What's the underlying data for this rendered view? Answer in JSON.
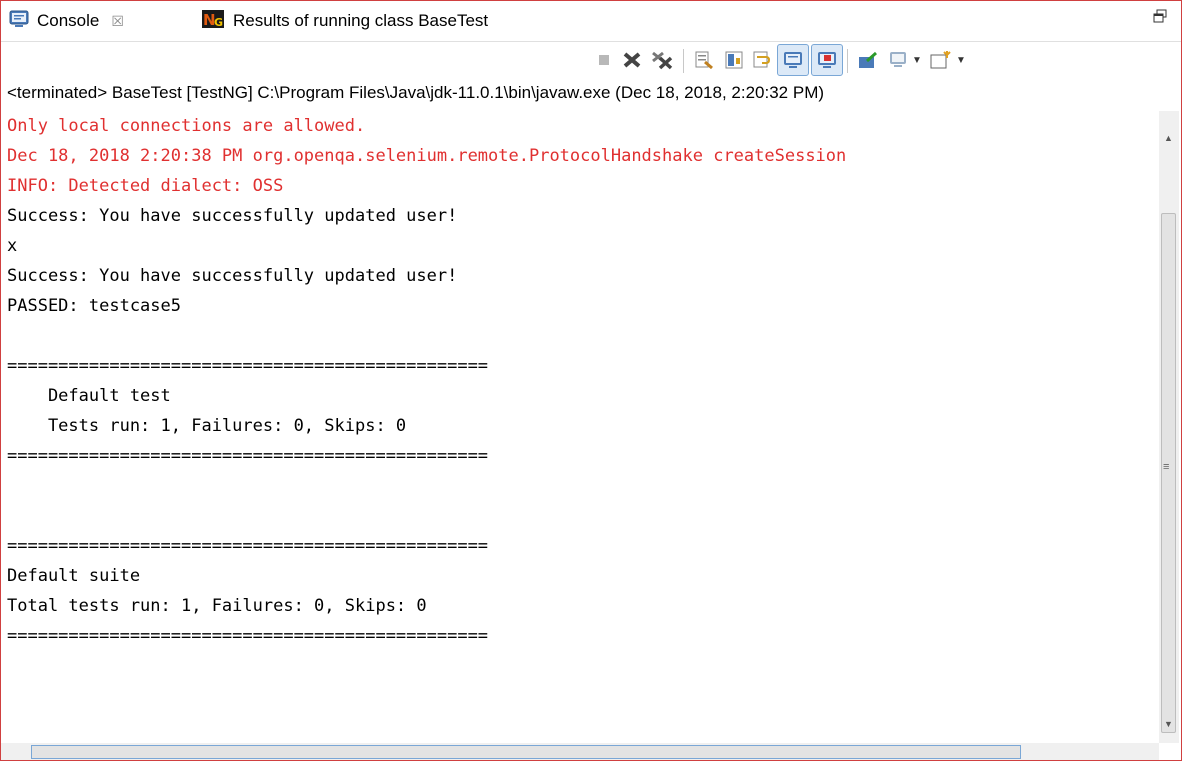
{
  "tabs": [
    {
      "label": "Console",
      "icon": "console-icon",
      "close": "☒"
    },
    {
      "label": "Results of running class BaseTest",
      "icon": "testng-icon"
    }
  ],
  "window_control": "restore-icon",
  "toolbar": {
    "icons": [
      "terminate-icon",
      "remove-launch-icon",
      "remove-all-launches-icon",
      "clear-console-icon",
      "scroll-lock-icon",
      "word-wrap-icon",
      "show-on-stdout-change-icon",
      "show-on-stderr-change-icon",
      "pin-console-icon",
      "display-console-icon",
      "open-console-icon"
    ]
  },
  "status_line": "<terminated> BaseTest [TestNG] C:\\Program Files\\Java\\jdk-11.0.1\\bin\\javaw.exe (Dec 18, 2018, 2:20:32 PM)",
  "console": {
    "lines": [
      {
        "text": "Only local connections are allowed.",
        "stream": "stderr"
      },
      {
        "text": "Dec 18, 2018 2:20:38 PM org.openqa.selenium.remote.ProtocolHandshake createSession",
        "stream": "stderr"
      },
      {
        "text": "INFO: Detected dialect: OSS",
        "stream": "stderr"
      },
      {
        "text": "Success: You have successfully updated user!",
        "stream": "stdout"
      },
      {
        "text": "x",
        "stream": "stdout"
      },
      {
        "text": "Success: You have successfully updated user!",
        "stream": "stdout"
      },
      {
        "text": "PASSED: testcase5",
        "stream": "stdout"
      },
      {
        "text": "",
        "stream": "stdout"
      },
      {
        "text": "===============================================",
        "stream": "stdout"
      },
      {
        "text": "    Default test",
        "stream": "stdout"
      },
      {
        "text": "    Tests run: 1, Failures: 0, Skips: 0",
        "stream": "stdout"
      },
      {
        "text": "===============================================",
        "stream": "stdout"
      },
      {
        "text": "",
        "stream": "stdout"
      },
      {
        "text": "",
        "stream": "stdout"
      },
      {
        "text": "===============================================",
        "stream": "stdout"
      },
      {
        "text": "Default suite",
        "stream": "stdout"
      },
      {
        "text": "Total tests run: 1, Failures: 0, Skips: 0",
        "stream": "stdout"
      },
      {
        "text": "===============================================",
        "stream": "stdout"
      }
    ]
  },
  "colors": {
    "stderr": "#e03030",
    "stdout": "#000000",
    "frame_border": "#d04040"
  }
}
